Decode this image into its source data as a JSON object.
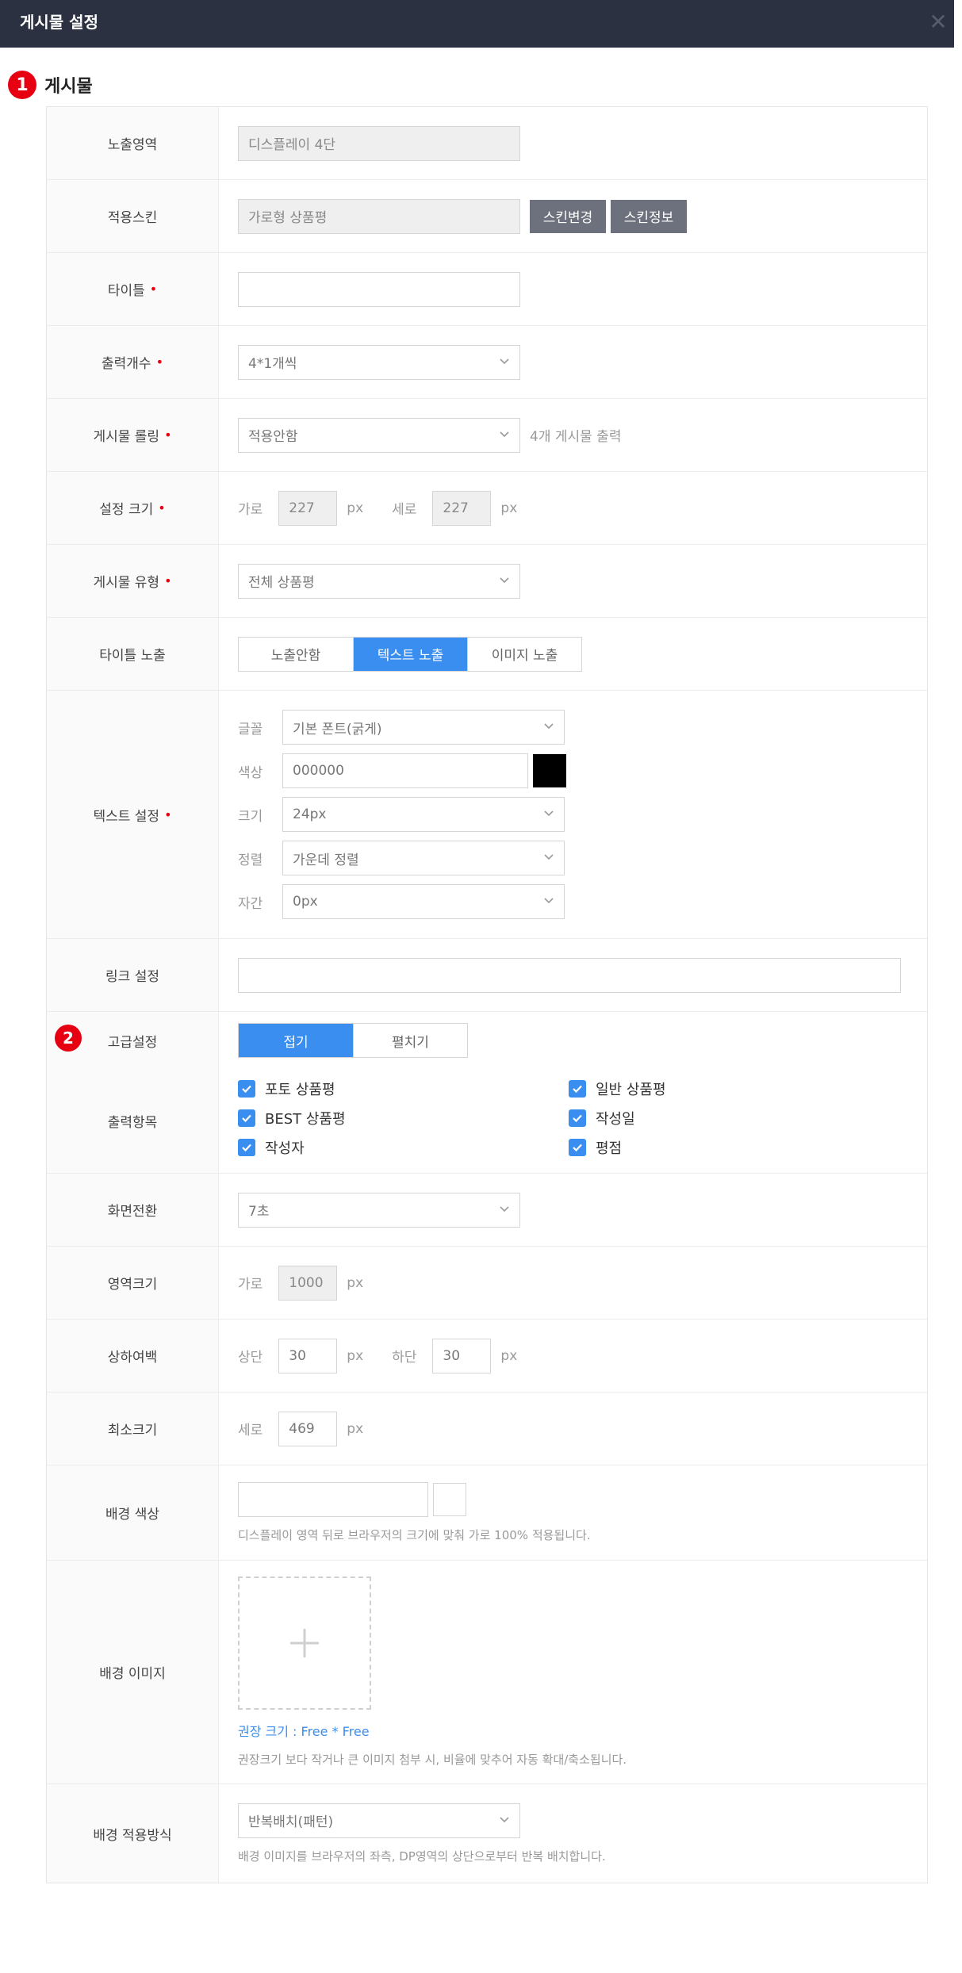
{
  "window": {
    "title": "게시물 설정",
    "close_glyph": "✕"
  },
  "section": {
    "number": "1",
    "title": "게시물"
  },
  "advanced_badge": "2",
  "rows": {
    "display_area": {
      "label": "노출영역",
      "value": "디스플레이 4단"
    },
    "skin": {
      "label": "적용스킨",
      "value": "가로형 상품평",
      "btn_change": "스킨변경",
      "btn_info": "스킨정보"
    },
    "title": {
      "label": "타이틀",
      "required": "•",
      "value": ""
    },
    "output_count": {
      "label": "출력개수",
      "required": "•",
      "value": "4*1개씩"
    },
    "rolling": {
      "label": "게시물 롤링",
      "required": "•",
      "value": "적용안함",
      "note": "4개 게시물 출력"
    },
    "size": {
      "label": "설정 크기",
      "required": "•",
      "w_label": "가로",
      "w_value": "227",
      "h_label": "세로",
      "h_value": "227",
      "unit": "px"
    },
    "post_type": {
      "label": "게시물 유형",
      "required": "•",
      "value": "전체 상품평"
    },
    "title_display": {
      "label": "타이틀 노출",
      "options": [
        "노출안함",
        "텍스트 노출",
        "이미지 노출"
      ],
      "active": "텍스트 노출"
    },
    "text_setting": {
      "label": "텍스트 설정",
      "required": "•",
      "font_label": "글꼴",
      "font_value": "기본 폰트(굵게)",
      "color_label": "색상",
      "color_value": "000000",
      "color_swatch": "#000000",
      "size_label": "크기",
      "size_value": "24px",
      "align_label": "정렬",
      "align_value": "가운데 정렬",
      "spacing_label": "자간",
      "spacing_value": "0px"
    },
    "link": {
      "label": "링크 설정",
      "value": ""
    },
    "advanced": {
      "label": "고급설정",
      "options": [
        "접기",
        "펼치기"
      ],
      "active": "접기"
    },
    "output_items": {
      "label": "출력항목",
      "items": [
        "포토 상품평",
        "일반 상품평",
        "BEST 상품평",
        "작성일",
        "작성자",
        "평점"
      ]
    },
    "transition": {
      "label": "화면전환",
      "value": "7초"
    },
    "area_size": {
      "label": "영역크기",
      "w_label": "가로",
      "w_value": "1000",
      "unit": "px"
    },
    "margin": {
      "label": "상하여백",
      "top_label": "상단",
      "top_value": "30",
      "bottom_label": "하단",
      "bottom_value": "30",
      "unit": "px"
    },
    "min_size": {
      "label": "최소크기",
      "h_label": "세로",
      "h_value": "469",
      "unit": "px"
    },
    "bg_color": {
      "label": "배경 색상",
      "value": "",
      "help": "디스플레이 영역 뒤로 브라우저의 크기에 맞춰 가로 100% 적용됩니다."
    },
    "bg_image": {
      "label": "배경 이미지",
      "plus": "+",
      "recommend": "권장 크기 : Free * Free",
      "help": "권장크기 보다 작거나 큰 이미지 첨부 시, 비율에 맞추어 자동 확대/축소됩니다."
    },
    "bg_method": {
      "label": "배경 적용방식",
      "value": "반복배치(패턴)",
      "help": "배경 이미지를 브라우저의 좌측, DP영역의 상단으로부터 반복 배치합니다."
    }
  },
  "colors": {
    "accent": "#3a8ef0",
    "required": "#e60012",
    "topbar": "#2b3140",
    "button_dark": "#6c717d"
  },
  "icons": {
    "chevron": "chevron-down-icon",
    "check": "check-icon",
    "plus": "plus-icon",
    "close": "close-icon"
  }
}
